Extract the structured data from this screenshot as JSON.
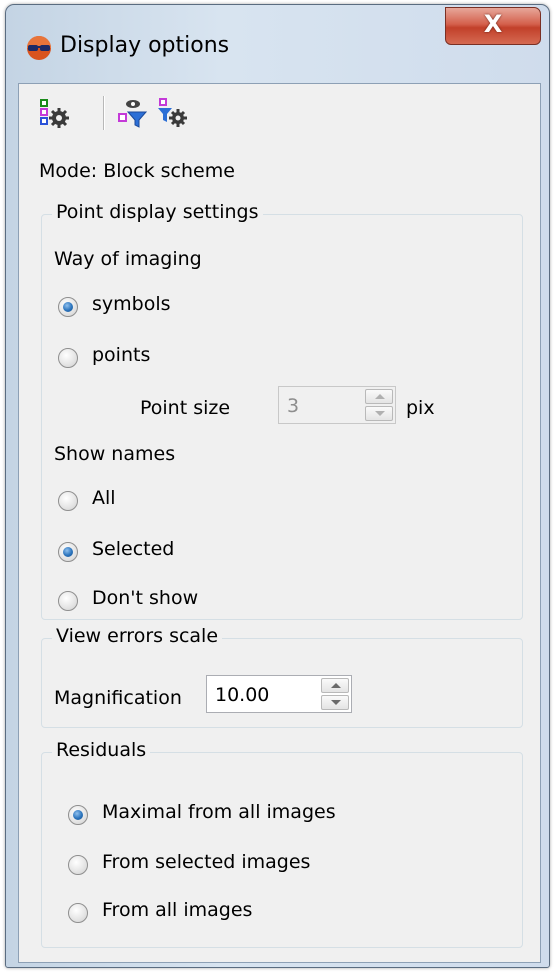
{
  "window": {
    "title": "Display options",
    "close_label": "X"
  },
  "toolbar": {
    "icons": [
      "settings-icon",
      "filter-view-icon",
      "filter-settings-icon"
    ]
  },
  "mode_text": "Mode: Block scheme",
  "point_display": {
    "title": "Point display settings",
    "way_of_imaging": "Way of imaging",
    "symbols": "symbols",
    "points": "points",
    "point_size_label": "Point size",
    "point_size_value": "3",
    "point_size_unit": "pix",
    "show_names": "Show names",
    "all": "All",
    "selected": "Selected",
    "dont_show": "Don't show",
    "imaging_selected": "symbols",
    "names_selected": "Selected"
  },
  "view_errors": {
    "title": "View errors scale",
    "magnification_label": "Magnification",
    "magnification_value": "10.00"
  },
  "residuals": {
    "title": "Residuals",
    "maximal": "Maximal from all images",
    "from_selected": "From selected images",
    "from_all": "From all images",
    "selected": "Maximal from all images"
  },
  "colors": {
    "accent": "#2b74bd",
    "close": "#c94a33",
    "panel": "#f0f0f0"
  }
}
